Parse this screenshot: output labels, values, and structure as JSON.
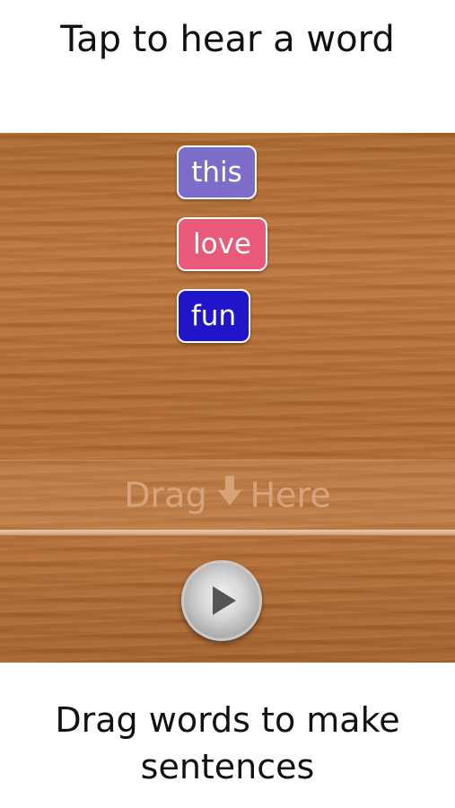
{
  "header": {
    "caption": "Tap to hear a word"
  },
  "board": {
    "words": [
      {
        "text": "this",
        "color": "#7c6dc8"
      },
      {
        "text": "love",
        "color": "#e9597a"
      },
      {
        "text": "fun",
        "color": "#2016c7"
      }
    ],
    "drop_zone": {
      "text_before": "Drag",
      "arrow_icon": "down-arrow-icon",
      "text_after": "Here"
    },
    "play_button": {
      "icon": "play-icon"
    }
  },
  "footer": {
    "caption_line1": "Drag words to make",
    "caption_line2": "sentences"
  },
  "colors": {
    "wood": "#b06c36",
    "hint_text": "#d6a37a"
  }
}
